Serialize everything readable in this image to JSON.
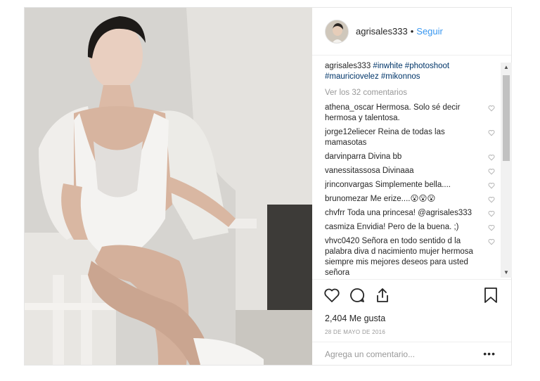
{
  "post": {
    "username": "agrisales333",
    "separator": "•",
    "follow_label": "Seguir",
    "caption": {
      "user": "agrisales333",
      "text": "#inwhite #photoshoot #mauriciovelez #mikonnos"
    },
    "view_all": "Ver los 32 comentarios",
    "comments": [
      {
        "user": "athena_oscar",
        "text": "Hermosa. Solo sé decir hermosa y talentosa."
      },
      {
        "user": "jorge12eliecer",
        "text": "Reina de todas las mamasotas"
      },
      {
        "user": "darvinparra",
        "text": "Divina bb"
      },
      {
        "user": "vanessitassosa",
        "text": "Divinaaa"
      },
      {
        "user": "jrinconvargas",
        "text": "Simplemente bella...."
      },
      {
        "user": "brunomezar",
        "text": "Me erize....😮😮😮"
      },
      {
        "user": "chvfrr",
        "text": "Toda una princesa! @agrisales333"
      },
      {
        "user": "casmiza",
        "text": "Envidia! Pero de la buena. ;)"
      },
      {
        "user": "vhvc0420",
        "text": "Señora en todo sentido d la palabra diva d nacimiento mujer hermosa siempre mis mejores deseos para usted señora"
      }
    ],
    "likes": "2,404 Me gusta",
    "date": "28 DE MAYO DE 2016",
    "add_comment_placeholder": "Agrega un comentario...",
    "more_label": "•••"
  },
  "icons": {
    "like": "heart-icon",
    "comment": "comment-icon",
    "share": "share-icon",
    "save": "bookmark-icon",
    "comment_like": "small-heart-icon"
  },
  "colors": {
    "link": "#3897f0",
    "hashtag": "#003569",
    "muted": "#999999",
    "text": "#262626"
  }
}
